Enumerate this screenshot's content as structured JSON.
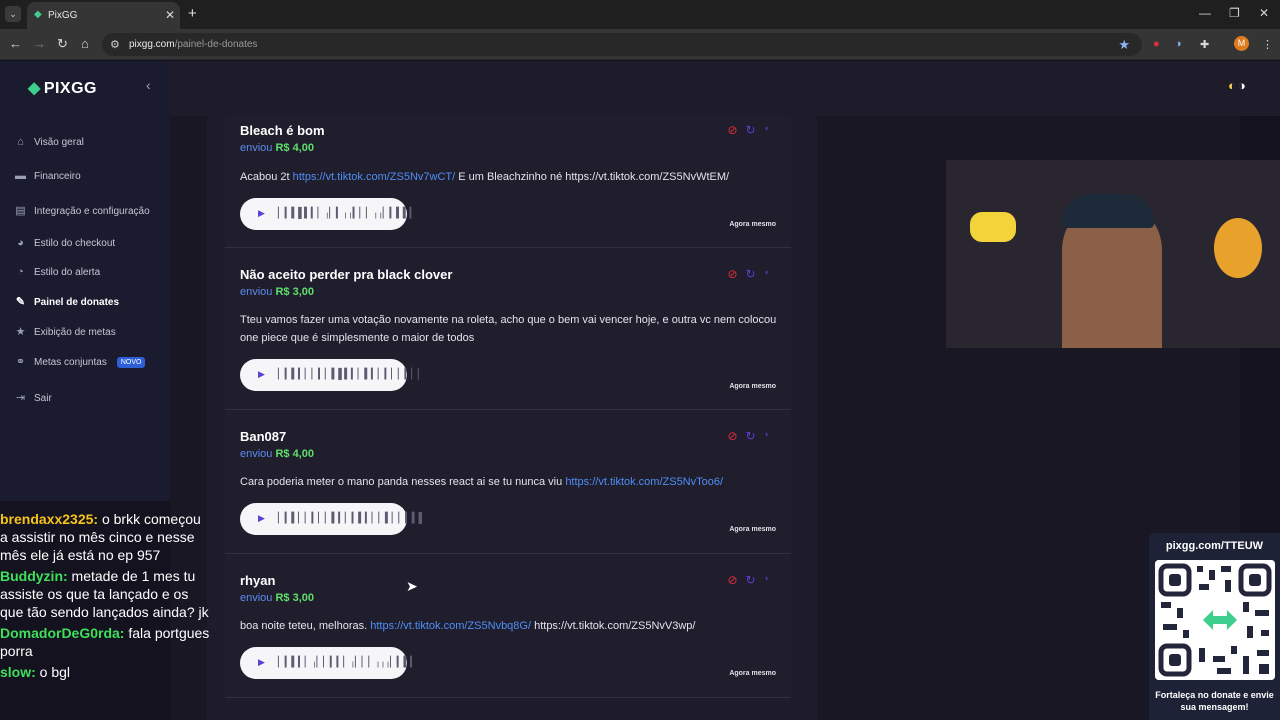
{
  "browser": {
    "tab_title": "PixGG",
    "url_host": "pixgg.com",
    "url_path": "/painel-de-donates",
    "profile_initial": "M"
  },
  "sidebar": {
    "logo": "PIXGG",
    "items": [
      {
        "label": "Visão geral",
        "icon": "home-icon"
      },
      {
        "label": "Financeiro",
        "icon": "wallet-icon"
      },
      {
        "label": "Integração e configuração",
        "icon": "document-icon"
      },
      {
        "label": "Estilo do checkout",
        "icon": "palette-icon"
      },
      {
        "label": "Estilo do alerta",
        "icon": "alert-style-icon"
      },
      {
        "label": "Painel de donates",
        "icon": "donates-icon",
        "active": true
      },
      {
        "label": "Exibição de metas",
        "icon": "star-icon"
      },
      {
        "label": "Metas conjuntas",
        "icon": "link-icon",
        "badge": "NOVO"
      },
      {
        "label": "Sair",
        "icon": "logout-icon"
      }
    ]
  },
  "donations": [
    {
      "name": "Bleach é bom",
      "sent_label": "enviou",
      "amount": "R$ 4,00",
      "message_parts": [
        {
          "text": "Acabou 2t ",
          "link": false
        },
        {
          "text": "https://vt.tiktok.com/ZS5Nv7wCT/",
          "link": true
        },
        {
          "text": " E um Bleachzinho né https://vt.tiktok.com/ZS5NvWtEM/",
          "link": false
        }
      ],
      "waveform": "▏▎▍▌▍▎▏╷▏▎╷╷▎▏▏╷╷▏▎▍▍▎",
      "time": "Agora mesmo"
    },
    {
      "name": "Não aceito perder pra black clover",
      "sent_label": "enviou",
      "amount": "R$ 3,00",
      "message_parts": [
        {
          "text": "Tteu vamos fazer uma votação novamente na roleta, acho que o bem vai vencer hoje, e outra vc nem colocou one piece que é simplesmente o maior de todos",
          "link": false
        }
      ],
      "waveform": "▏▎▍▎▏▏▎▏▍▌▍▎▏▍▎▏▎▏▏▎▏▏",
      "time": "Agora mesmo"
    },
    {
      "name": "Ban087",
      "sent_label": "enviou",
      "amount": "R$ 4,00",
      "message_parts": [
        {
          "text": "Cara poderia meter o mano panda nesses react ai se tu nunca viu ",
          "link": false
        },
        {
          "text": "https://vt.tiktok.com/ZS5NvToo6/",
          "link": true
        }
      ],
      "waveform": "▏▎▍▏▏▎▏▏▍▎▏▎▍▎▏▏▍▏▏▎▍▌",
      "time": "Agora mesmo"
    },
    {
      "name": "rhyan",
      "sent_label": "enviou",
      "amount": "R$ 3,00",
      "message_parts": [
        {
          "text": "boa noite teteu, melhoras. ",
          "link": false
        },
        {
          "text": "https://vt.tiktok.com/ZS5Nvbq8G/",
          "link": true
        },
        {
          "text": " https://vt.tiktok.com/ZS5NvV3wp/",
          "link": false
        }
      ],
      "waveform": "▏▎▍▎▏╷▏▏▎▎▏╷▏▏▏╷╷╷▏▎▍▎",
      "time": "Agora mesmo"
    }
  ],
  "chat": [
    {
      "user": "brendaxx2325:",
      "color": "#f5c518",
      "text": " o brkk começou a assistir no mês cinco e nesse mês ele já está no ep 957"
    },
    {
      "user": "Buddyzin:",
      "color": "#3ee05a",
      "text": " metade de 1 mes tu assiste os que ta lançado e os que tão sendo lançados ainda? jk"
    },
    {
      "user": "DomadorDeG0rda:",
      "color": "#3ee05a",
      "text": " fala portgues porra"
    },
    {
      "user": "slow:",
      "color": "#3ee05a",
      "text": " o bgl"
    }
  ],
  "qr_overlay": {
    "title": "pixgg.com/TTEUW",
    "footer": "Fortaleça no donate e envie sua mensagem!"
  },
  "colors": {
    "accent": "#3ecf8e",
    "amount": "#5ee06b",
    "link": "#4f8ff7",
    "block": "#e0303a",
    "replay": "#5b3fd8"
  }
}
